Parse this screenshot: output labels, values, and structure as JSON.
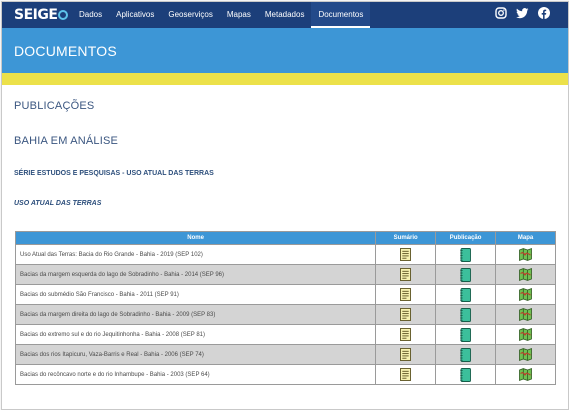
{
  "nav": {
    "logo_part1": "SEI",
    "logo_part2": "GE",
    "items": [
      {
        "label": "Dados"
      },
      {
        "label": "Aplicativos"
      },
      {
        "label": "Geoserviços"
      },
      {
        "label": "Mapas"
      },
      {
        "label": "Metadados"
      },
      {
        "label": "Documentos",
        "active": true
      }
    ],
    "social_icons": [
      "instagram-icon",
      "twitter-icon",
      "facebook-icon"
    ]
  },
  "banner": {
    "title": "DOCUMENTOS"
  },
  "colors": {
    "navbar": "#1c3f7a",
    "banner": "#3d96d6",
    "accent_bar": "#ece14a",
    "table_header": "#3d96d6"
  },
  "sections": {
    "publicacoes": "PUBLICAÇÕES",
    "bahia": "BAHIA EM ANÁLISE",
    "serie": "SÉRIE ESTUDOS E PESQUISAS - USO ATUAL DAS TERRAS",
    "uso": "USO ATUAL DAS TERRAS"
  },
  "table": {
    "headers": [
      "Nome",
      "Sumário",
      "Publicação",
      "Mapa"
    ],
    "icons": {
      "sumario": "document-icon",
      "publicacao": "notebook-icon",
      "mapa": "map-icon"
    },
    "rows": [
      {
        "name": "Uso Atual das Terras: Bacia do Rio Grande - Bahia - 2019 (SEP 102)"
      },
      {
        "name": "Bacias da margem esquerda do lago de Sobradinho - Bahia - 2014 (SEP 96)"
      },
      {
        "name": "Bacias do submédio São Francisco - Bahia - 2011 (SEP 91)"
      },
      {
        "name": "Bacias da margem direita do lago de Sobradinho - Bahia - 2009 (SEP 83)"
      },
      {
        "name": "Bacias do extremo sul e do rio Jequitinhonha - Bahia - 2008 (SEP 81)"
      },
      {
        "name": "Bacias dos rios Itapicuru, Vaza-Barris e Real - Bahia - 2006 (SEP 74)"
      },
      {
        "name": "Bacias do recôncavo norte e do rio Inhambupe - Bahia - 2003 (SEP 64)"
      }
    ]
  }
}
